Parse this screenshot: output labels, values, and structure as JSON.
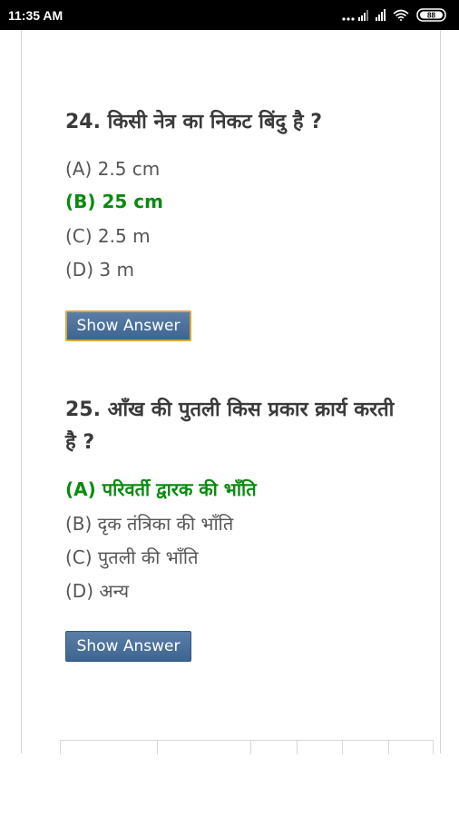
{
  "status_bar": {
    "time": "11:35 AM",
    "icons": [
      "dots-icon",
      "signal-icon",
      "signal-icon",
      "wifi-icon",
      "battery-icon"
    ],
    "battery": "88"
  },
  "questions": [
    {
      "text": "24. किसी नेत्र का निकट बिंदु है ?",
      "options": [
        {
          "label": "(A) 2.5 cm",
          "correct": false
        },
        {
          "label": "(B) 25 cm",
          "correct": true
        },
        {
          "label": "(C) 2.5 m",
          "correct": false
        },
        {
          "label": "(D) 3 m",
          "correct": false
        }
      ],
      "button_label": "Show Answer"
    },
    {
      "text": "25. आँख की पुतली किस प्रकार क्रार्य करती है ?",
      "options": [
        {
          "label": "(A) परिवर्ती द्वारक की भाँति",
          "correct": true
        },
        {
          "label": "(B) दृक तंत्रिका की भाँति",
          "correct": false
        },
        {
          "label": "(C) पुतली की भाँति",
          "correct": false
        },
        {
          "label": "(D) अन्य",
          "correct": false
        }
      ],
      "button_label": "Show Answer"
    }
  ],
  "colors": {
    "correct_option": "#0a8a10",
    "button_bg": "#4a6f9b",
    "button_focus_border": "#d9a63c"
  }
}
